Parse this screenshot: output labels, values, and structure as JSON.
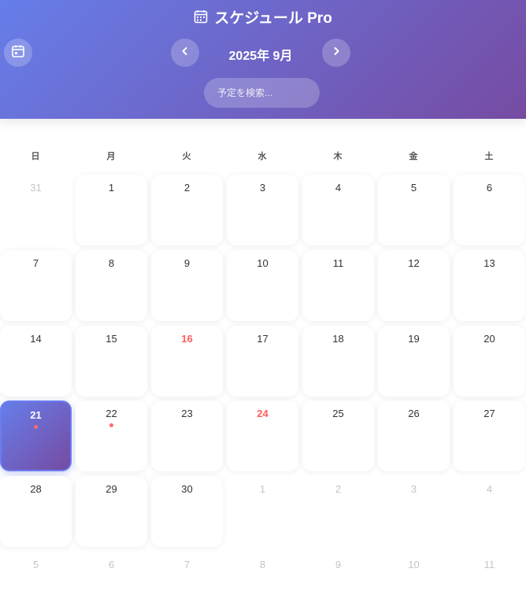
{
  "header": {
    "title": "スケジュール Pro",
    "month_label": "2025年 9月",
    "search_placeholder": "予定を検索..."
  },
  "colors": {
    "gradient_start": "#667eea",
    "gradient_end": "#764ba2",
    "holiday": "#ff5c5c",
    "event_dot": "#ff6b6b",
    "other_month_text": "#c4c4c4"
  },
  "icons": {
    "title": "calendar-icon",
    "today_button": "calendar-today-icon",
    "prev": "chevron-left-icon",
    "next": "chevron-right-icon"
  },
  "weekdays": [
    "日",
    "月",
    "火",
    "水",
    "木",
    "金",
    "土"
  ],
  "weeks": [
    [
      {
        "day": "31",
        "other": true
      },
      {
        "day": "1"
      },
      {
        "day": "2"
      },
      {
        "day": "3"
      },
      {
        "day": "4"
      },
      {
        "day": "5"
      },
      {
        "day": "6"
      }
    ],
    [
      {
        "day": "7"
      },
      {
        "day": "8"
      },
      {
        "day": "9"
      },
      {
        "day": "10"
      },
      {
        "day": "11"
      },
      {
        "day": "12"
      },
      {
        "day": "13"
      }
    ],
    [
      {
        "day": "14"
      },
      {
        "day": "15"
      },
      {
        "day": "16",
        "holiday": true
      },
      {
        "day": "17"
      },
      {
        "day": "18"
      },
      {
        "day": "19"
      },
      {
        "day": "20"
      }
    ],
    [
      {
        "day": "21",
        "selected": true,
        "event": true
      },
      {
        "day": "22",
        "event": true
      },
      {
        "day": "23"
      },
      {
        "day": "24",
        "holiday": true
      },
      {
        "day": "25"
      },
      {
        "day": "26"
      },
      {
        "day": "27"
      }
    ],
    [
      {
        "day": "28"
      },
      {
        "day": "29"
      },
      {
        "day": "30"
      },
      {
        "day": "1",
        "other": true
      },
      {
        "day": "2",
        "other": true
      },
      {
        "day": "3",
        "other": true
      },
      {
        "day": "4",
        "other": true
      }
    ],
    [
      {
        "day": "5",
        "other": true
      },
      {
        "day": "6",
        "other": true
      },
      {
        "day": "7",
        "other": true
      },
      {
        "day": "8",
        "other": true
      },
      {
        "day": "9",
        "other": true
      },
      {
        "day": "10",
        "other": true
      },
      {
        "day": "11",
        "other": true
      }
    ]
  ]
}
